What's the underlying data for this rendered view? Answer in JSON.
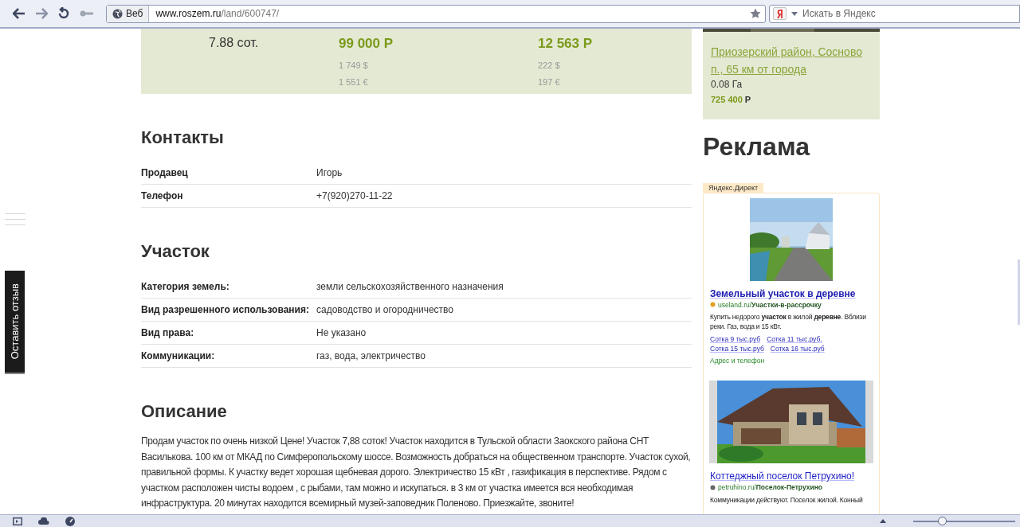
{
  "browser": {
    "web_label": "Веб",
    "url_host": "www.roszem.ru",
    "url_path": "/land/600747/",
    "search_placeholder": "Искать в Яндекс"
  },
  "summary": {
    "area": "7.88 сот.",
    "price": "99 000 Р",
    "price_usd": "1 749 $",
    "price_eur": "1 551 €",
    "price_per": "12 563 Р",
    "price_per_usd": "222 $",
    "price_per_eur": "197 €"
  },
  "sections": [
    {
      "title": "Контакты",
      "rows": [
        {
          "label": "Продавец",
          "value": "Игорь"
        },
        {
          "label": "Телефон",
          "value": "+7(920)270-11-22"
        }
      ]
    },
    {
      "title": "Участок",
      "rows": [
        {
          "label": "Категория земель:",
          "value": "земли сельскохозяйственного назначения"
        },
        {
          "label": "Вид разрешенного использования:",
          "value": "садоводство и огородничество"
        },
        {
          "label": "Вид права:",
          "value": "Не указано"
        },
        {
          "label": "Коммуникации:",
          "value": "газ, вода, электричество"
        }
      ]
    }
  ],
  "description": {
    "title": "Описание",
    "text": "Продам участок по очень низкой Цене! Участок 7,88 соток! Участок находится в Тульской области Заокского района СНТ Василькова. 100 км от МКАД по Симферопольскому шоссе. Возможность добраться на общественном транспорте. Участок сухой, правильной формы. К участку ведет хорошая щебневая дорого. Электричество 15 кВт , газификация в перспективе. Рядом с участком расположен чисты водоем , с рыбами, там можно и искупаться. в 3 км от участка имеется вся необходимая инфраструктура. 20 минутах находится всемирный музей-заповедник Поленово. Приезжайте, звоните!"
  },
  "similar": {
    "link": "Приозерский район, Сосново п., 65 км от города",
    "area": "0.08 Га",
    "price_number": "725 400",
    "price_currency": "Р"
  },
  "ads": {
    "title": "Реклама",
    "badge": "Яндекс.Директ",
    "items": [
      {
        "title": "Земельный участок в деревне",
        "domain": "useland.ru/",
        "path": "Участки-в-рассрочку",
        "text": "Купить недорого **участок** в жилой **деревне**. Вблизи реки. Газ, вода и 15 кВт.",
        "sitelinks": [
          "Сотка 9 тыс.руб",
          "Сотка 11 тыс.руб.",
          "Сотка 15 тыс.руб",
          "Сотка 16 тыс.руб"
        ],
        "contact": "Адрес и телефон"
      },
      {
        "title": "Коттеджный поселок Петрухино!",
        "domain": "petruhino.ru/",
        "path": "Поселок-Петрухино",
        "text": "Коммуникации действуют. Поселок жилой. Конный"
      }
    ]
  },
  "feedback_tab": "Оставить отзыв",
  "status_bar": {
    "zoom": {
      "level": 0.28
    }
  }
}
